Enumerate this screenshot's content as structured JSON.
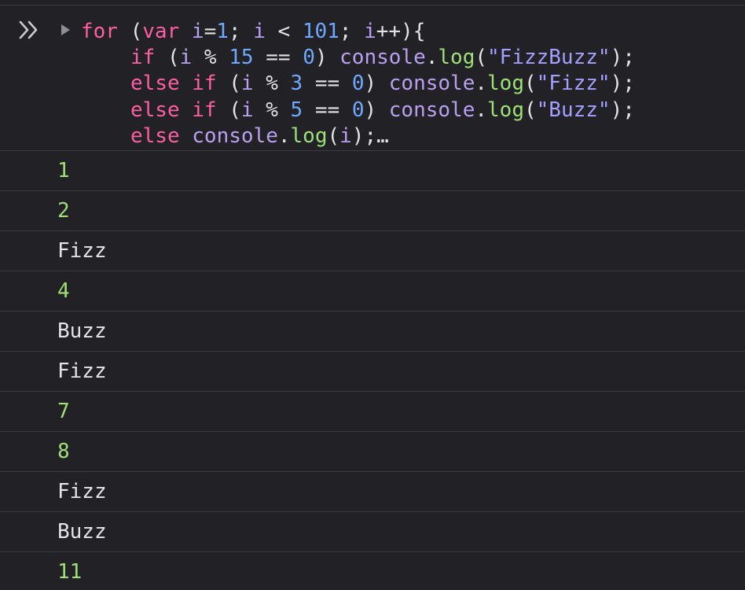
{
  "input": {
    "lines": [
      [
        {
          "t": "for",
          "c": "kw"
        },
        {
          "t": " (",
          "c": "plain"
        },
        {
          "t": "var",
          "c": "kw"
        },
        {
          "t": " ",
          "c": "plain"
        },
        {
          "t": "i",
          "c": "ident"
        },
        {
          "t": "=",
          "c": "plain"
        },
        {
          "t": "1",
          "c": "num"
        },
        {
          "t": "; ",
          "c": "plain"
        },
        {
          "t": "i",
          "c": "ident"
        },
        {
          "t": " < ",
          "c": "plain"
        },
        {
          "t": "101",
          "c": "num"
        },
        {
          "t": "; ",
          "c": "plain"
        },
        {
          "t": "i",
          "c": "ident"
        },
        {
          "t": "++){",
          "c": "plain"
        }
      ],
      [
        {
          "t": "if",
          "c": "kw"
        },
        {
          "t": " (",
          "c": "plain"
        },
        {
          "t": "i",
          "c": "ident"
        },
        {
          "t": " % ",
          "c": "plain"
        },
        {
          "t": "15",
          "c": "num"
        },
        {
          "t": " == ",
          "c": "plain"
        },
        {
          "t": "0",
          "c": "num"
        },
        {
          "t": ") ",
          "c": "plain"
        },
        {
          "t": "console",
          "c": "ident"
        },
        {
          "t": ".",
          "c": "plain"
        },
        {
          "t": "log",
          "c": "fn"
        },
        {
          "t": "(",
          "c": "plain"
        },
        {
          "t": "\"FizzBuzz\"",
          "c": "str"
        },
        {
          "t": ");",
          "c": "plain"
        }
      ],
      [
        {
          "t": "else",
          "c": "kw"
        },
        {
          "t": " ",
          "c": "plain"
        },
        {
          "t": "if",
          "c": "kw"
        },
        {
          "t": " (",
          "c": "plain"
        },
        {
          "t": "i",
          "c": "ident"
        },
        {
          "t": " % ",
          "c": "plain"
        },
        {
          "t": "3",
          "c": "num"
        },
        {
          "t": " == ",
          "c": "plain"
        },
        {
          "t": "0",
          "c": "num"
        },
        {
          "t": ") ",
          "c": "plain"
        },
        {
          "t": "console",
          "c": "ident"
        },
        {
          "t": ".",
          "c": "plain"
        },
        {
          "t": "log",
          "c": "fn"
        },
        {
          "t": "(",
          "c": "plain"
        },
        {
          "t": "\"Fizz\"",
          "c": "str"
        },
        {
          "t": ");",
          "c": "plain"
        }
      ],
      [
        {
          "t": "else",
          "c": "kw"
        },
        {
          "t": " ",
          "c": "plain"
        },
        {
          "t": "if",
          "c": "kw"
        },
        {
          "t": " (",
          "c": "plain"
        },
        {
          "t": "i",
          "c": "ident"
        },
        {
          "t": " % ",
          "c": "plain"
        },
        {
          "t": "5",
          "c": "num"
        },
        {
          "t": " == ",
          "c": "plain"
        },
        {
          "t": "0",
          "c": "num"
        },
        {
          "t": ") ",
          "c": "plain"
        },
        {
          "t": "console",
          "c": "ident"
        },
        {
          "t": ".",
          "c": "plain"
        },
        {
          "t": "log",
          "c": "fn"
        },
        {
          "t": "(",
          "c": "plain"
        },
        {
          "t": "\"Buzz\"",
          "c": "str"
        },
        {
          "t": ");",
          "c": "plain"
        }
      ],
      [
        {
          "t": "else",
          "c": "kw"
        },
        {
          "t": " ",
          "c": "plain"
        },
        {
          "t": "console",
          "c": "ident"
        },
        {
          "t": ".",
          "c": "plain"
        },
        {
          "t": "log",
          "c": "fn"
        },
        {
          "t": "(",
          "c": "plain"
        },
        {
          "t": "i",
          "c": "ident"
        },
        {
          "t": ");",
          "c": "plain"
        },
        {
          "t": "…",
          "c": "ellipsis"
        }
      ]
    ]
  },
  "output": [
    {
      "value": "1",
      "kind": "number"
    },
    {
      "value": "2",
      "kind": "number"
    },
    {
      "value": "Fizz",
      "kind": "string"
    },
    {
      "value": "4",
      "kind": "number"
    },
    {
      "value": "Buzz",
      "kind": "string"
    },
    {
      "value": "Fizz",
      "kind": "string"
    },
    {
      "value": "7",
      "kind": "number"
    },
    {
      "value": "8",
      "kind": "number"
    },
    {
      "value": "Fizz",
      "kind": "string"
    },
    {
      "value": "Buzz",
      "kind": "string"
    },
    {
      "value": "11",
      "kind": "number"
    }
  ],
  "icons": {
    "prompt": "prompt-chevrons-icon",
    "disclosure": "disclosure-triangle-icon"
  },
  "colors": {
    "background": "#212126",
    "keyword": "#fc5fa3",
    "number": "#6fa8ff",
    "string": "#a4a0ff",
    "identifier": "#b9a0f0",
    "function": "#9fe077",
    "output_number": "#9fe077",
    "output_string": "#e4e4e7",
    "divider": "#3b3b40"
  }
}
